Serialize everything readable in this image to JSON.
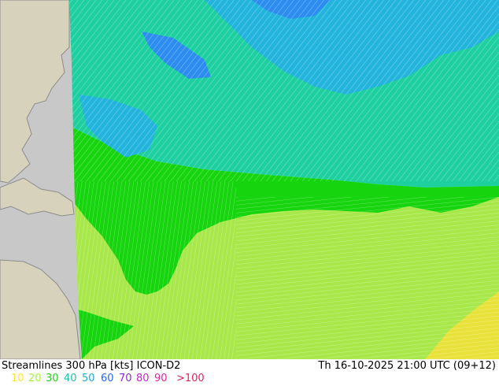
{
  "title": "Streamlines 300 hPa [kts] ICON-D2",
  "valid_time": "Th 16-10-2025 21:00 UTC (09+12)",
  "legend": [
    {
      "label": "10",
      "color": "#fce63c"
    },
    {
      "label": "20",
      "color": "#a6f03a"
    },
    {
      "label": "30",
      "color": "#28d21e"
    },
    {
      "label": "40",
      "color": "#1ec3a5"
    },
    {
      "label": "50",
      "color": "#1eaadc"
    },
    {
      "label": "60",
      "color": "#2864ff"
    },
    {
      "label": "70",
      "color": "#9628dc"
    },
    {
      "label": "80",
      "color": "#c828c8"
    },
    {
      "label": "90",
      "color": "#dc28a0"
    },
    {
      "label": ">100",
      "color": "#e61e5a"
    }
  ],
  "colors": {
    "sea": "#c8c8c8",
    "land": "#d6d2bc",
    "coast": "#8c8c8c",
    "speed_10": "#e8e23a",
    "speed_20": "#a8e84a",
    "speed_30": "#16d40e",
    "speed_40": "#1ecfa0",
    "speed_50": "#22b4dc",
    "speed_60": "#2c8cf0"
  }
}
